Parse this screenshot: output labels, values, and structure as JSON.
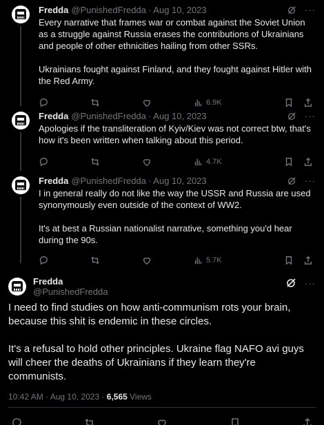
{
  "replies": [
    {
      "name": "Fredda",
      "handle": "@PunishedFredda",
      "separator": "·",
      "date": "Aug 10, 2023",
      "text": "Every narrative that frames war or combat against the Soviet Union as a struggle against Russia erases the contributions of Ukrainians and people of other ethnicities hailing from other SSRs.\n\nUkrainians fought against Finland, and they fought against Hitler with the Red Army.",
      "views": "6.9K"
    },
    {
      "name": "Fredda",
      "handle": "@PunishedFredda",
      "separator": "·",
      "date": "Aug 10, 2023",
      "text": "Apologies if the transliteration of Kyiv/Kiev was not correct btw, that's how it's been written when talking about this period.",
      "views": "4.7K"
    },
    {
      "name": "Fredda",
      "handle": "@PunishedFredda",
      "separator": "·",
      "date": "Aug 10, 2023",
      "text": "I in general really do not like the way the USSR and Russia are used synonymously even outside of the context of WW2.\n\nIt's at best a Russian nationalist narrative, something you'd hear during the 90s.",
      "views": "5.7K"
    }
  ],
  "main": {
    "name": "Fredda",
    "handle": "@PunishedFredda",
    "text": "I need to find studies on how anti-communism rots your brain, because this shit is endemic in these circles.\n\nIt's a refusal to hold other principles. Ukraine flag NAFO avi guys will cheer the deaths of Ukrainians if they learn they're communists.",
    "timestamp": "10:42 AM · Aug 10, 2023 · ",
    "views_count": "6,565",
    "views_label": " Views"
  },
  "more_label": "···",
  "colors": {
    "background": "#000000",
    "text": "#e7e9ea",
    "muted": "#71767b",
    "divider": "#2f3336"
  }
}
